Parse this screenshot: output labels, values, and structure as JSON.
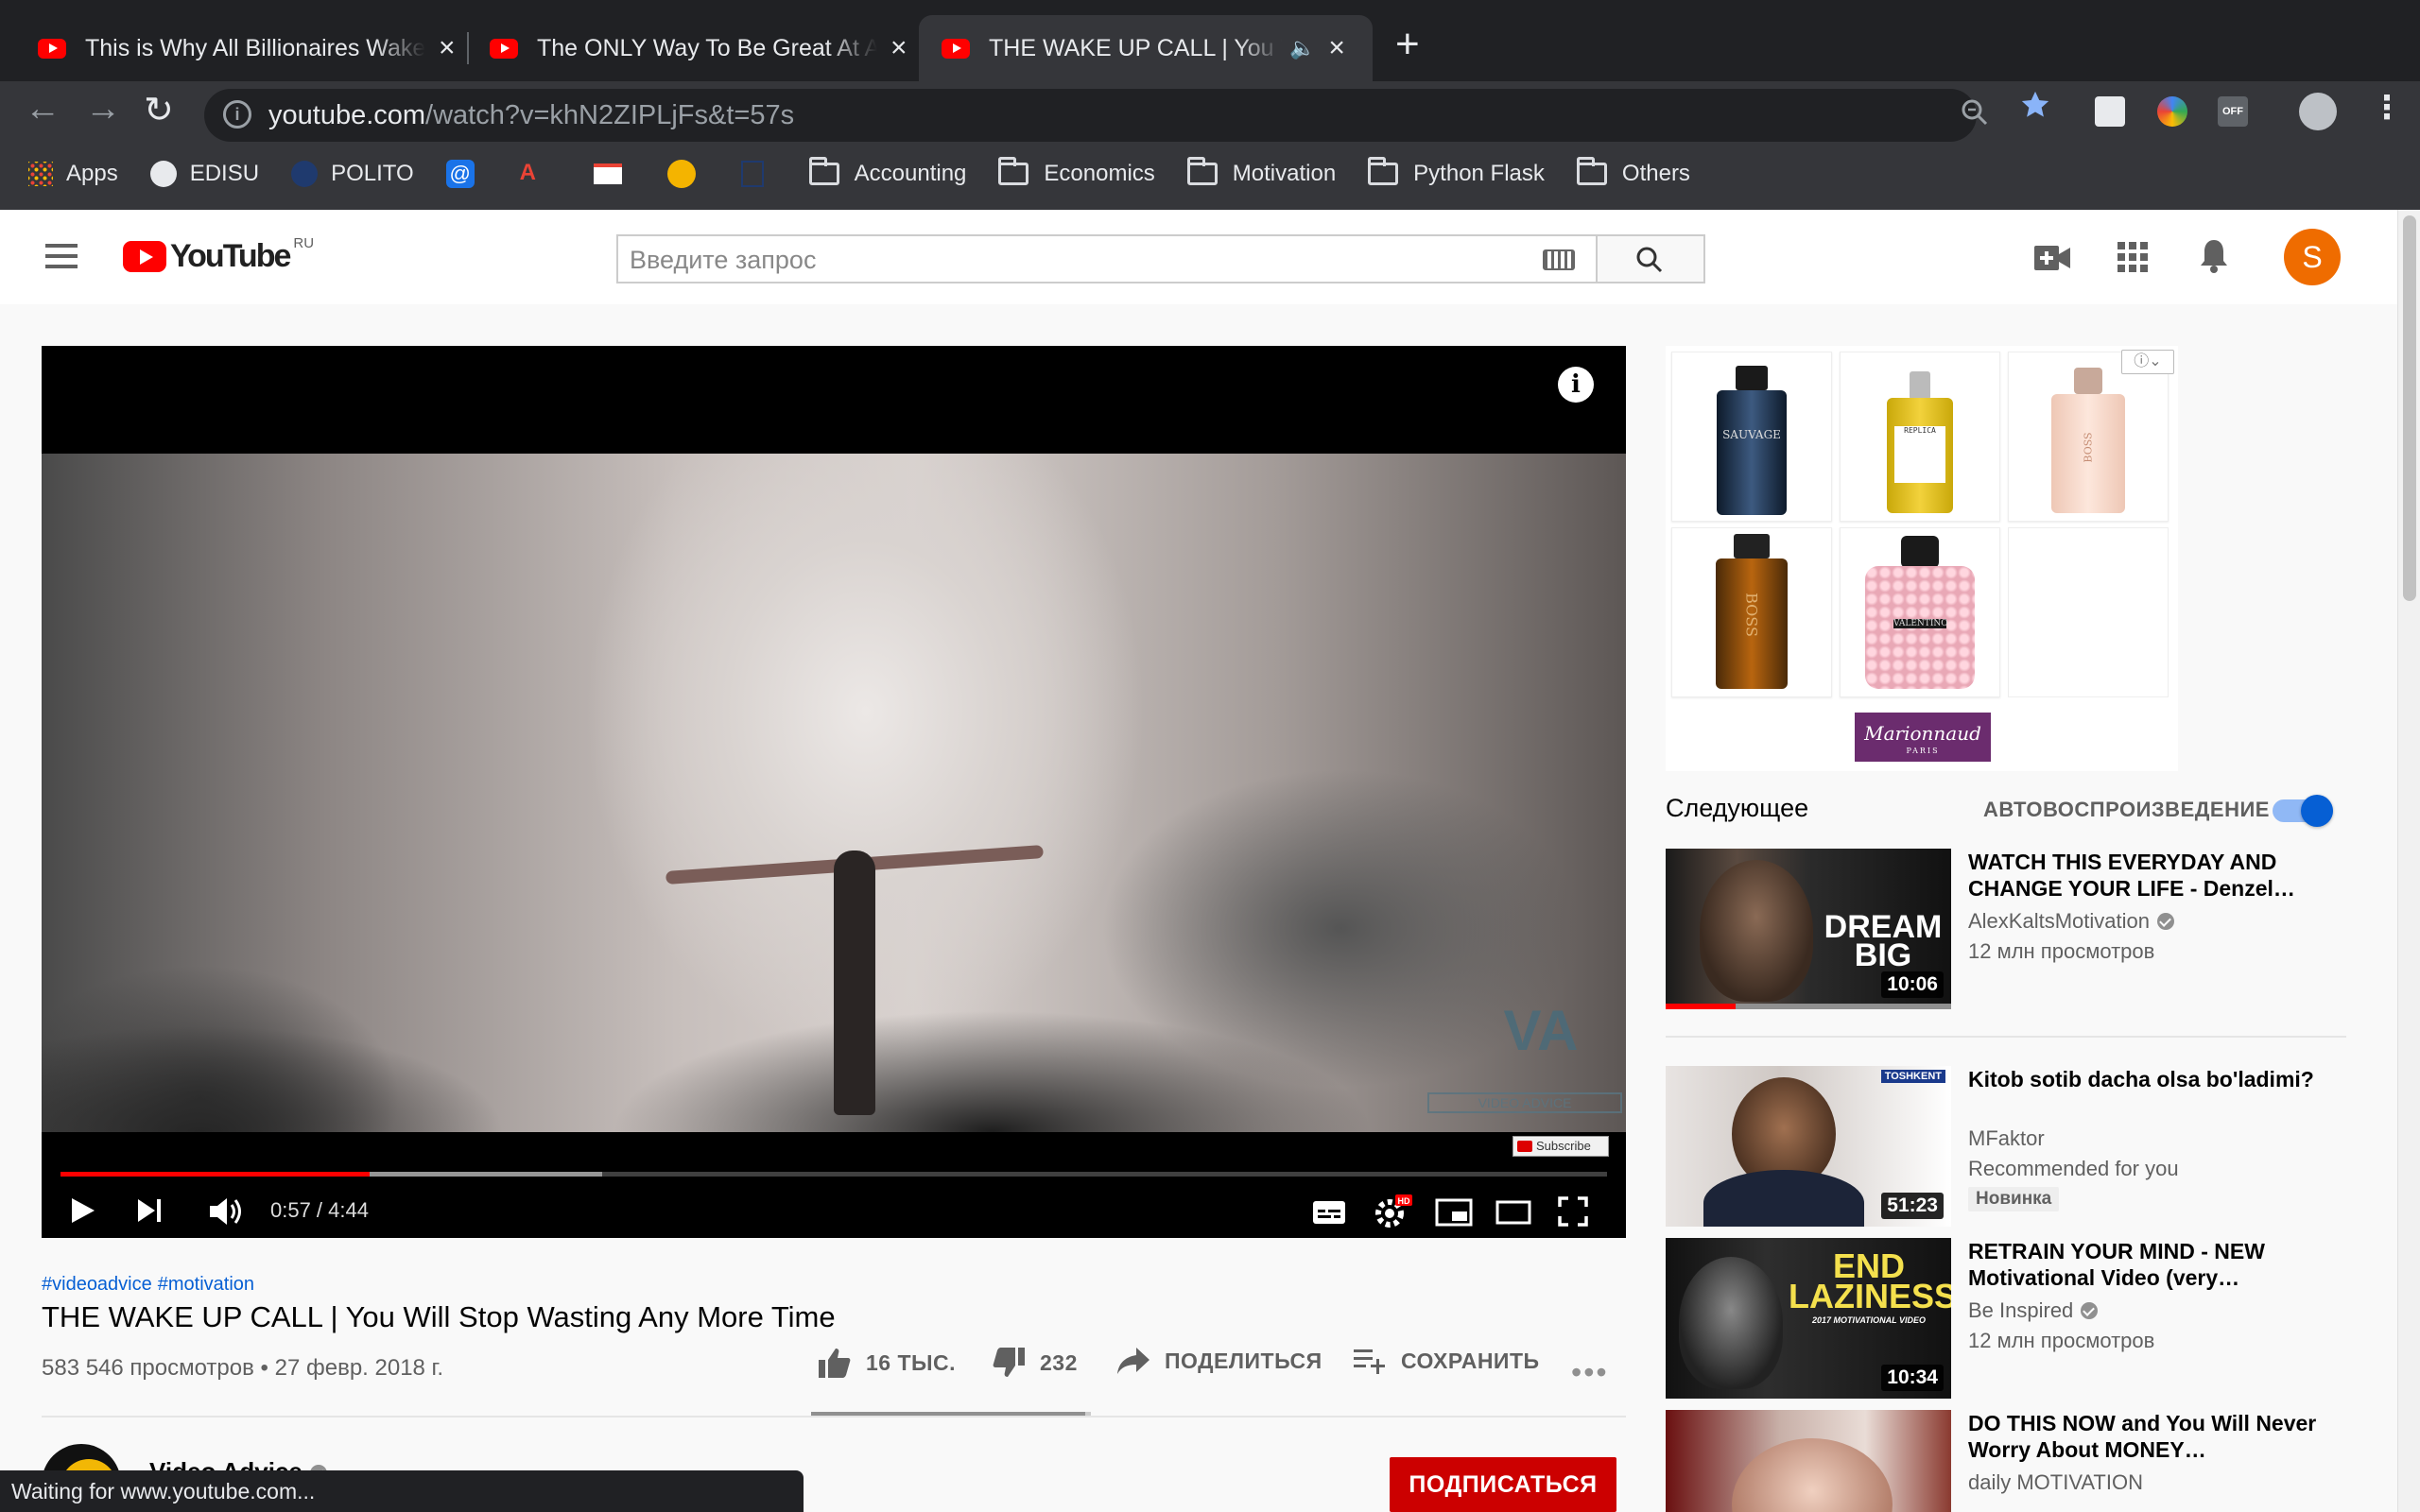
{
  "browser": {
    "tabs": [
      {
        "title": "This is Why All Billionaires Wake",
        "active": false
      },
      {
        "title": "The ONLY Way To Be Great At Anything",
        "active": false
      },
      {
        "title": "THE WAKE UP CALL | You Will",
        "active": true
      }
    ],
    "url_host": "youtube.com",
    "url_path": "/watch?v=khN2ZIPLjFs&t=57s",
    "bookmarks": [
      {
        "label": "Apps",
        "icon": "apps-grid-icon"
      },
      {
        "label": "EDISU",
        "icon": "globe-icon"
      },
      {
        "label": "POLITO",
        "icon": "polito-icon"
      },
      {
        "label": "",
        "icon": "at-sign-icon"
      },
      {
        "label": "",
        "icon": "translate-icon"
      },
      {
        "label": "",
        "icon": "gmail-icon"
      },
      {
        "label": "",
        "icon": "coin-icon"
      },
      {
        "label": "",
        "icon": "document-icon"
      },
      {
        "label": "Accounting",
        "icon": "folder-icon"
      },
      {
        "label": "Economics",
        "icon": "folder-icon"
      },
      {
        "label": "Motivation",
        "icon": "folder-icon"
      },
      {
        "label": "Python Flask",
        "icon": "folder-icon"
      },
      {
        "label": "Others",
        "icon": "folder-icon"
      }
    ],
    "status_text": "Waiting for www.youtube.com..."
  },
  "youtube": {
    "logo_text": "YouTube",
    "region": "RU",
    "search_placeholder": "Введите запрос",
    "avatar_letter": "S",
    "accent": "#ff0000"
  },
  "player": {
    "time": "0:57 / 4:44",
    "played_fraction": 0.2,
    "buffered_fraction": 0.35,
    "overlay_logo": "VA",
    "overlay_text": "VIDEO ADVICE",
    "subscribe_badge": "Subscribe"
  },
  "video": {
    "hashtags": [
      "#videoadvice",
      "#motivation"
    ],
    "title": "THE WAKE UP CALL | You Will Stop Wasting Any More Time",
    "views_date": "583 546 просмотров • 27 февр. 2018 г.",
    "likes": "16 ТЫС.",
    "dislikes": "232",
    "share": "ПОДЕЛИТЬСЯ",
    "save": "СОХРАНИТЬ",
    "like_ratio": 0.98,
    "channel": "Video Advice",
    "subscribe": "ПОДПИСАТЬСЯ"
  },
  "ad": {
    "products": [
      "SAUVAGE",
      "REPLICA",
      "BOSS",
      "BOSS",
      "VALENTINO"
    ],
    "brand": "Marionnaud",
    "brand_sub": "PARIS"
  },
  "upnext": {
    "label": "Следующее",
    "autoplay_label": "АВТОВОСПРОИЗВЕДЕНИЕ",
    "autoplay_on": true,
    "items": [
      {
        "title": "WATCH THIS EVERYDAY AND CHANGE YOUR LIFE - Denzel…",
        "channel": "AlexKaltsMotivation",
        "meta": "12 млн просмотров",
        "duration": "10:06",
        "thumb_text": "DREAM BIG",
        "verified": true
      },
      {
        "title": "Kitob sotib dacha olsa bo'ladimi?",
        "channel": "MFaktor",
        "meta": "Recommended for you",
        "duration": "51:23",
        "thumb_text": "TOSHKENT",
        "badge": "Новинка",
        "verified": false
      },
      {
        "title": "RETRAIN YOUR MIND - NEW Motivational Video (very…",
        "channel": "Be Inspired",
        "meta": "12 млн просмотров",
        "duration": "10:34",
        "thumb_text": "END LAZINESS",
        "thumb_sub": "2017 MOTIVATIONAL VIDEO",
        "verified": true
      },
      {
        "title": "DO THIS NOW and You Will Never Worry About MONEY…",
        "channel": "daily MOTIVATION",
        "meta": "",
        "duration": "",
        "verified": false
      }
    ]
  }
}
